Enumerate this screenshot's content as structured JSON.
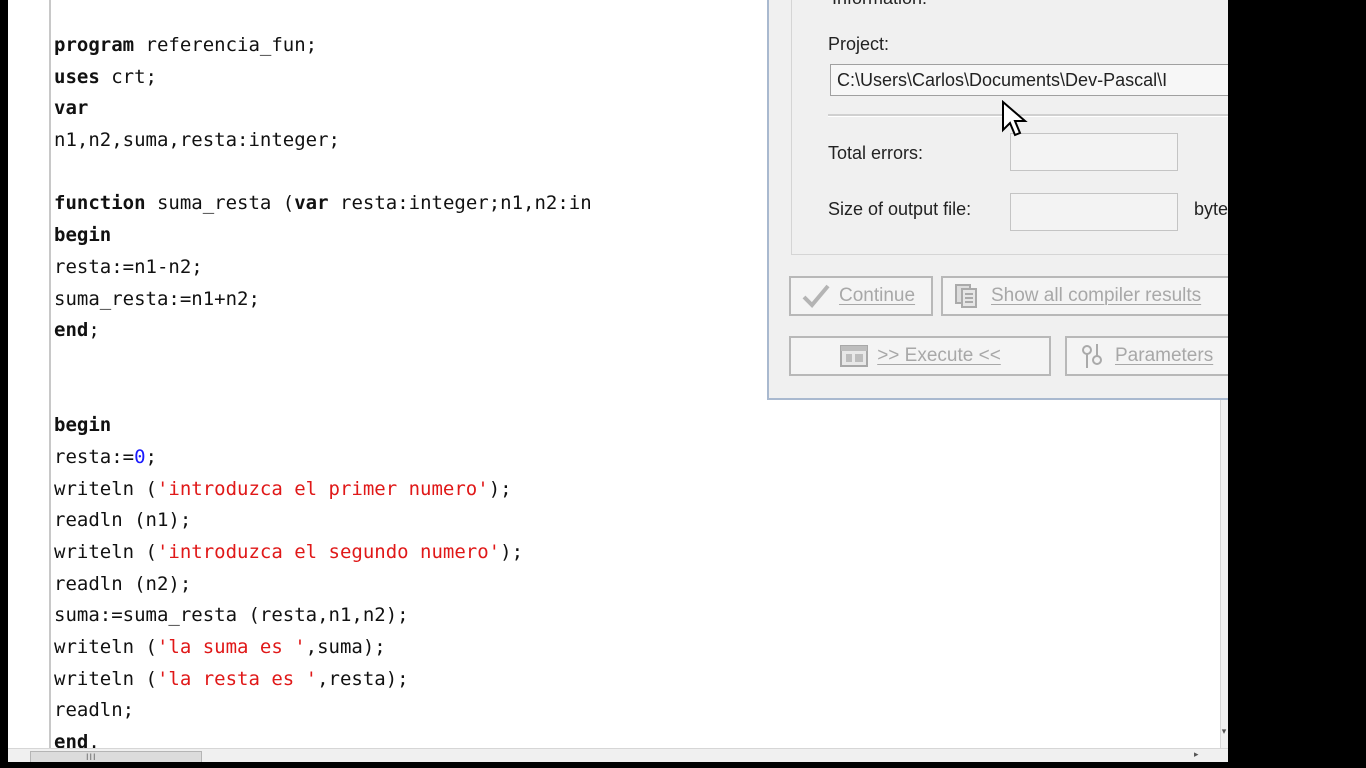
{
  "editor": {
    "lines": [
      [
        {
          "t": "program",
          "k": "kw"
        },
        {
          "t": " referencia_fun;"
        }
      ],
      [
        {
          "t": "uses",
          "k": "kw"
        },
        {
          "t": " crt;"
        }
      ],
      [
        {
          "t": "var",
          "k": "kw"
        }
      ],
      [
        {
          "t": "n1,n2,suma,resta:integer;"
        }
      ],
      [],
      [
        {
          "t": "function",
          "k": "kw"
        },
        {
          "t": " suma_resta (",
          "k": ""
        },
        {
          "t": "var",
          "k": "kw"
        },
        {
          "t": " resta:integer;n1,n2:in"
        }
      ],
      [
        {
          "t": "begin",
          "k": "kw"
        }
      ],
      [
        {
          "t": "resta:=n1-n2;"
        }
      ],
      [
        {
          "t": "suma_resta:=n1+n2;"
        }
      ],
      [
        {
          "t": "end",
          "k": "kw"
        },
        {
          "t": ";"
        }
      ],
      [],
      [],
      [
        {
          "t": "begin",
          "k": "kw"
        }
      ],
      [
        {
          "t": "resta:="
        },
        {
          "t": "0",
          "k": "num"
        },
        {
          "t": ";"
        }
      ],
      [
        {
          "t": "writeln ("
        },
        {
          "t": "'introduzca el primer numero'",
          "k": "str"
        },
        {
          "t": ");"
        }
      ],
      [
        {
          "t": "readln (n1);"
        }
      ],
      [
        {
          "t": "writeln ("
        },
        {
          "t": "'introduzca el segundo numero'",
          "k": "str"
        },
        {
          "t": ");"
        }
      ],
      [
        {
          "t": "readln (n2);"
        }
      ],
      [
        {
          "t": "suma:=suma_resta (resta,n1,n2);"
        }
      ],
      [
        {
          "t": "writeln ("
        },
        {
          "t": "'la suma es '",
          "k": "str"
        },
        {
          "t": ",suma);"
        }
      ],
      [
        {
          "t": "writeln ("
        },
        {
          "t": "'la resta es '",
          "k": "str"
        },
        {
          "t": ",resta);"
        }
      ],
      [
        {
          "t": "readln;"
        }
      ],
      [
        {
          "t": "end",
          "k": "kw"
        },
        {
          "t": "."
        }
      ]
    ]
  },
  "dialog": {
    "group_title": "Information:",
    "project_label": "Project:",
    "project_path": "C:\\Users\\Carlos\\Documents\\Dev-Pascal\\I",
    "total_errors_label": "Total errors:",
    "total_errors_value": "",
    "output_size_label": "Size of output file:",
    "output_size_value": "",
    "bytes_label": "bytes",
    "buttons": {
      "continue": "Continue",
      "show_all": "Show all compiler results",
      "execute": ">> Execute <<",
      "parameters": "Parameters"
    }
  },
  "scrollbar": {
    "grip": "III"
  }
}
